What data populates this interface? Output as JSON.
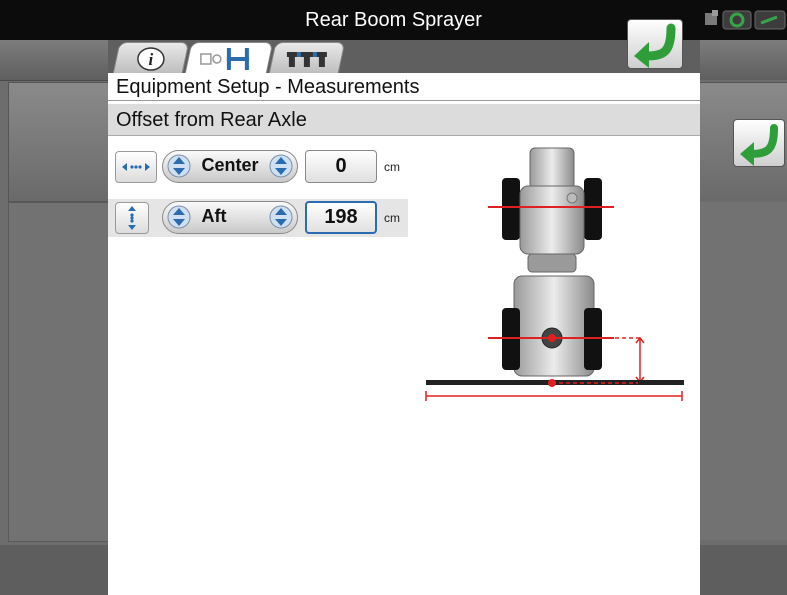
{
  "window": {
    "title": "Rear Boom Sprayer"
  },
  "tabs": [
    {
      "name": "info",
      "icon": "info-icon",
      "active": false
    },
    {
      "name": "measurements",
      "icon": "equipment-measure-icon",
      "active": true
    },
    {
      "name": "sections",
      "icon": "boom-sections-icon",
      "active": false
    }
  ],
  "page": {
    "heading": "Equipment Setup - Measurements",
    "subheading": "Offset from Rear Axle"
  },
  "rows": [
    {
      "axis_icon": "horizontal-arrows-icon",
      "direction": "Center",
      "value": "0",
      "unit": "cm"
    },
    {
      "axis_icon": "vertical-arrows-icon",
      "direction": "Aft",
      "value": "198",
      "unit": "cm"
    }
  ],
  "icons": {
    "back": "back-arrow-icon",
    "status": [
      "gps-status-icon",
      "antenna-icon",
      "connection-icon"
    ]
  },
  "colors": {
    "accent_blue": "#2b6cb0",
    "back_green": "#2f9e3a",
    "diagram_red": "#e02020",
    "title_bar": "#0c0c0c"
  }
}
